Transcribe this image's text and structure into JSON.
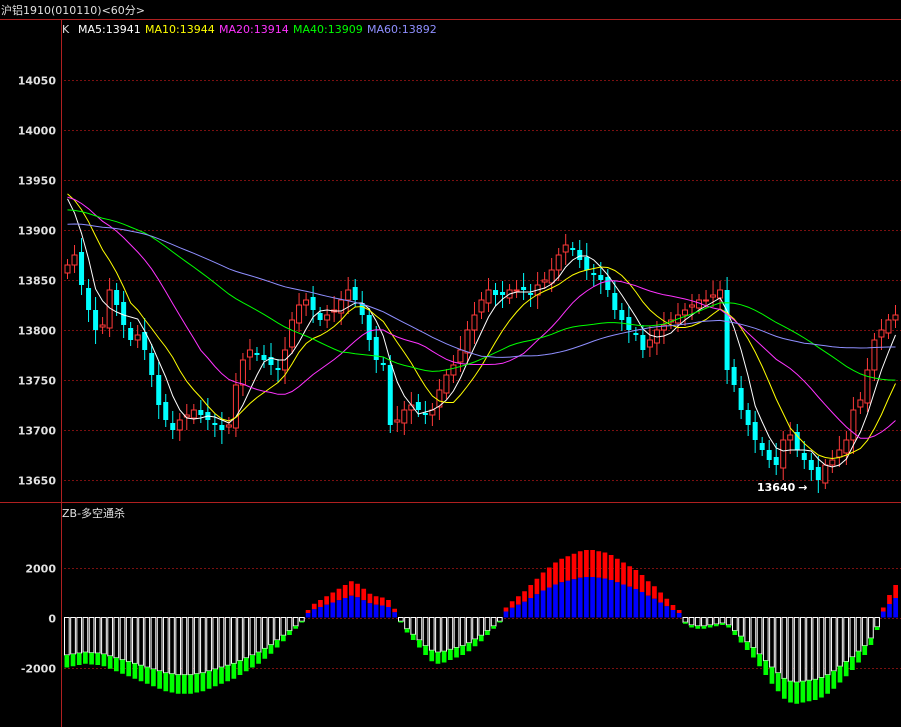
{
  "header": {
    "symbol": "沪铝1910",
    "code": "(010110)",
    "period": "<60分>"
  },
  "colors": {
    "background": "#000000",
    "frame": "#b02020",
    "grid": "#7a1010",
    "up": "#ff3a3a",
    "down": "#00ffff",
    "ma5": "#ffffff",
    "ma10": "#ffff00",
    "ma20": "#ff33ff",
    "ma40": "#00ff00",
    "ma60": "#8f8fff",
    "zb_red": "#ff0000",
    "zb_blue": "#0000ff",
    "zb_green": "#00ff00",
    "zb_white": "#ffffff"
  },
  "main_panel": {
    "label": "K",
    "legend": [
      {
        "name": "MA5",
        "value": "13941",
        "text": "MA5:13941",
        "color": "#ffffff"
      },
      {
        "name": "MA10",
        "value": "13944",
        "text": "MA10:13944",
        "color": "#ffff00"
      },
      {
        "name": "MA20",
        "value": "13914",
        "text": "MA20:13914",
        "color": "#ff33ff"
      },
      {
        "name": "MA40",
        "value": "13909",
        "text": "MA40:13909",
        "color": "#00ff00"
      },
      {
        "name": "MA60",
        "value": "13892",
        "text": "MA60:13892",
        "color": "#8f8fff"
      }
    ],
    "low_annotation": "13640",
    "low_arrow": "→"
  },
  "sub_panel": {
    "label": "ZB-多空通杀"
  },
  "chart_data": [
    {
      "type": "candlestick",
      "title": "沪铝1910(010110)<60分>",
      "ylim": [
        13625,
        14075
      ],
      "yticks": [
        13650,
        13700,
        13750,
        13800,
        13850,
        13900,
        13950,
        14000,
        14050
      ],
      "ytick_labels": [
        "13650",
        "13700",
        "13750",
        "13800",
        "13850",
        "13900",
        "13950",
        "14000",
        "14050"
      ],
      "grid": true,
      "closes": [
        13865,
        13875,
        13845,
        13820,
        13800,
        13805,
        13840,
        13825,
        13805,
        13790,
        13795,
        13780,
        13755,
        13725,
        13710,
        13700,
        13710,
        13715,
        13720,
        13715,
        13710,
        13705,
        13700,
        13705,
        13745,
        13770,
        13780,
        13775,
        13770,
        13765,
        13760,
        13780,
        13810,
        13825,
        13830,
        13820,
        13810,
        13815,
        13820,
        13830,
        13840,
        13830,
        13815,
        13790,
        13770,
        13765,
        13705,
        13710,
        13720,
        13725,
        13720,
        13715,
        13720,
        13740,
        13755,
        13765,
        13780,
        13800,
        13815,
        13830,
        13840,
        13835,
        13835,
        13840,
        13840,
        13840,
        13835,
        13845,
        13850,
        13860,
        13875,
        13885,
        13880,
        13870,
        13860,
        13855,
        13850,
        13840,
        13820,
        13810,
        13800,
        13795,
        13780,
        13790,
        13800,
        13805,
        13810,
        13815,
        13820,
        13825,
        13830,
        13830,
        13835,
        13840,
        13760,
        13745,
        13720,
        13705,
        13690,
        13680,
        13670,
        13665,
        13690,
        13695,
        13680,
        13670,
        13660,
        13650,
        13665,
        13670,
        13680,
        13690,
        13720,
        13730,
        13760,
        13790,
        13800,
        13810,
        13815
      ],
      "low_mark": 13640,
      "series_count": 5
    },
    {
      "type": "bar",
      "title": "ZB-多空通杀",
      "ylim": [
        -3000,
        4000
      ],
      "yticks": [
        2000,
        0,
        -2000
      ],
      "ytick_labels": [
        "2000",
        "0",
        "-2000"
      ],
      "values": [
        -2000,
        -1950,
        -1900,
        -1850,
        -1880,
        -1900,
        -1950,
        -2050,
        -2150,
        -2250,
        -2350,
        -2450,
        -2550,
        -2650,
        -2750,
        -2850,
        -2950,
        -3000,
        -3050,
        -3050,
        -3050,
        -3000,
        -2950,
        -2850,
        -2750,
        -2650,
        -2550,
        -2450,
        -2300,
        -2150,
        -2000,
        -1850,
        -1650,
        -1450,
        -1200,
        -950,
        -700,
        -450,
        -200,
        300,
        550,
        700,
        850,
        1000,
        1150,
        1300,
        1450,
        1350,
        1150,
        950,
        850,
        800,
        700,
        350,
        -200,
        -600,
        -900,
        -1200,
        -1500,
        -1750,
        -1850,
        -1800,
        -1700,
        -1600,
        -1500,
        -1350,
        -1150,
        -950,
        -700,
        -450,
        -200,
        400,
        650,
        850,
        1050,
        1300,
        1550,
        1800,
        2000,
        2200,
        2350,
        2450,
        2550,
        2650,
        2700,
        2700,
        2650,
        2600,
        2500,
        2350,
        2200,
        2050,
        1900,
        1700,
        1450,
        1250,
        1000,
        750,
        500,
        300,
        -250,
        -400,
        -450,
        -450,
        -400,
        -350,
        -300,
        -400,
        -700,
        -1000,
        -1300,
        -1600,
        -1950,
        -2300,
        -2650,
        -2950,
        -3250,
        -3400,
        -3450,
        -3400,
        -3350,
        -3300,
        -3200,
        -3050,
        -2850,
        -2600,
        -2350,
        -2100,
        -1800,
        -1500,
        -1100,
        -500,
        400,
        900,
        1300
      ]
    }
  ]
}
